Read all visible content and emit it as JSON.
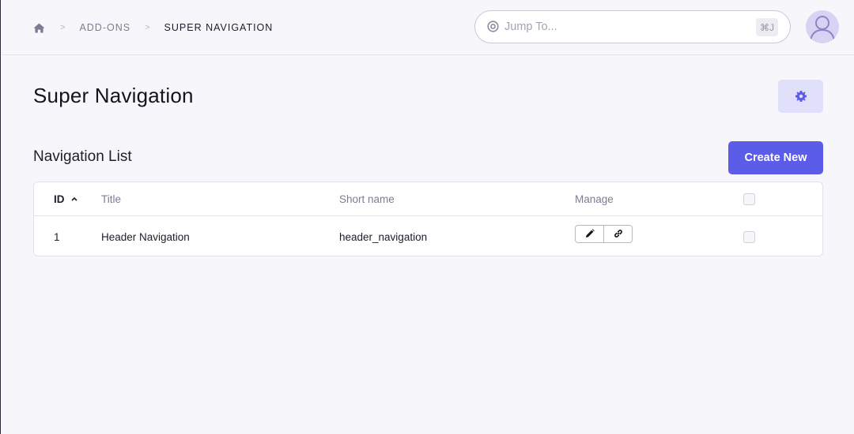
{
  "breadcrumb": {
    "home_icon": "home-icon",
    "separator": ">",
    "items": [
      {
        "label": "Add-Ons"
      },
      {
        "label": "Super Navigation"
      }
    ]
  },
  "jump": {
    "placeholder": "Jump To...",
    "shortcut": "⌘J",
    "icon": "target-icon"
  },
  "user": {
    "avatar_icon": "user-avatar-icon"
  },
  "page": {
    "title": "Super Navigation",
    "settings_icon": "gear-icon"
  },
  "list": {
    "title": "Navigation List",
    "create_label": "Create New",
    "columns": {
      "id": "ID",
      "title": "Title",
      "short_name": "Short name",
      "manage": "Manage"
    },
    "rows": [
      {
        "id": "1",
        "title": "Header Navigation",
        "short_name": "header_navigation"
      }
    ]
  },
  "colors": {
    "accent": "#5b5ce8",
    "accent_soft": "#e0e0fb",
    "background": "#f7f7fb"
  }
}
